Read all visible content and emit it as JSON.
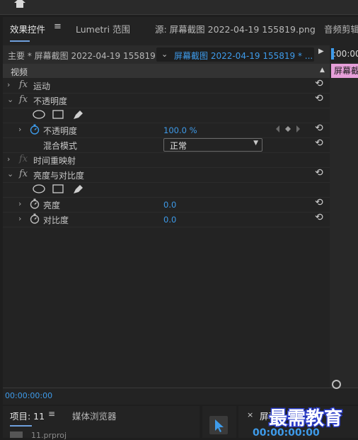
{
  "tabs": {
    "effect_controls": "效果控件",
    "lumetri_scopes": "Lumetri 范围",
    "source": "源: 屏幕截图 2022-04-19  155819.png",
    "audio_clip_mixer": "音频剪辑"
  },
  "menu_glyph": "≡",
  "source_row": {
    "master": "主要 * 屏幕截图 2022-04-19 155819...",
    "clip": "屏幕截图 2022-04-19 155819 * ..."
  },
  "timeline": {
    "timecode": ":00:00",
    "clip_label": "屏幕截图"
  },
  "section": {
    "label": "视频"
  },
  "effects": [
    {
      "name": "motion",
      "label": "运动",
      "expanded": false,
      "fx_enabled": true
    },
    {
      "name": "opacity",
      "label": "不透明度",
      "expanded": true,
      "fx_enabled": true
    },
    {
      "name": "time-remap",
      "label": "时间重映射",
      "expanded": false,
      "fx_enabled": false
    },
    {
      "name": "brightness-contrast",
      "label": "亮度与对比度",
      "expanded": true,
      "fx_enabled": true
    }
  ],
  "params": {
    "opacity": {
      "label": "不透明度",
      "value": "100.0 %"
    },
    "blend_mode": {
      "label": "混合模式",
      "value": "正常"
    },
    "brightness": {
      "label": "亮度",
      "value": "0.0"
    },
    "contrast": {
      "label": "对比度",
      "value": "0.0"
    }
  },
  "fx_glyph": "fx",
  "bottom_timecode": "00:00:00:00",
  "bottom_panels": {
    "project_tab": "项目: 11",
    "media_browser_tab": "媒体浏览器",
    "project_file": "11.prproj",
    "program_title": "屏幕",
    "program_timecode": "00:00:00:00",
    "close_glyph": "×"
  },
  "watermark": "最需教育",
  "colors": {
    "accent_blue": "#3e9bea",
    "clip_pink": "#e69fd9",
    "watermark_stroke": "#2a3cc8"
  }
}
